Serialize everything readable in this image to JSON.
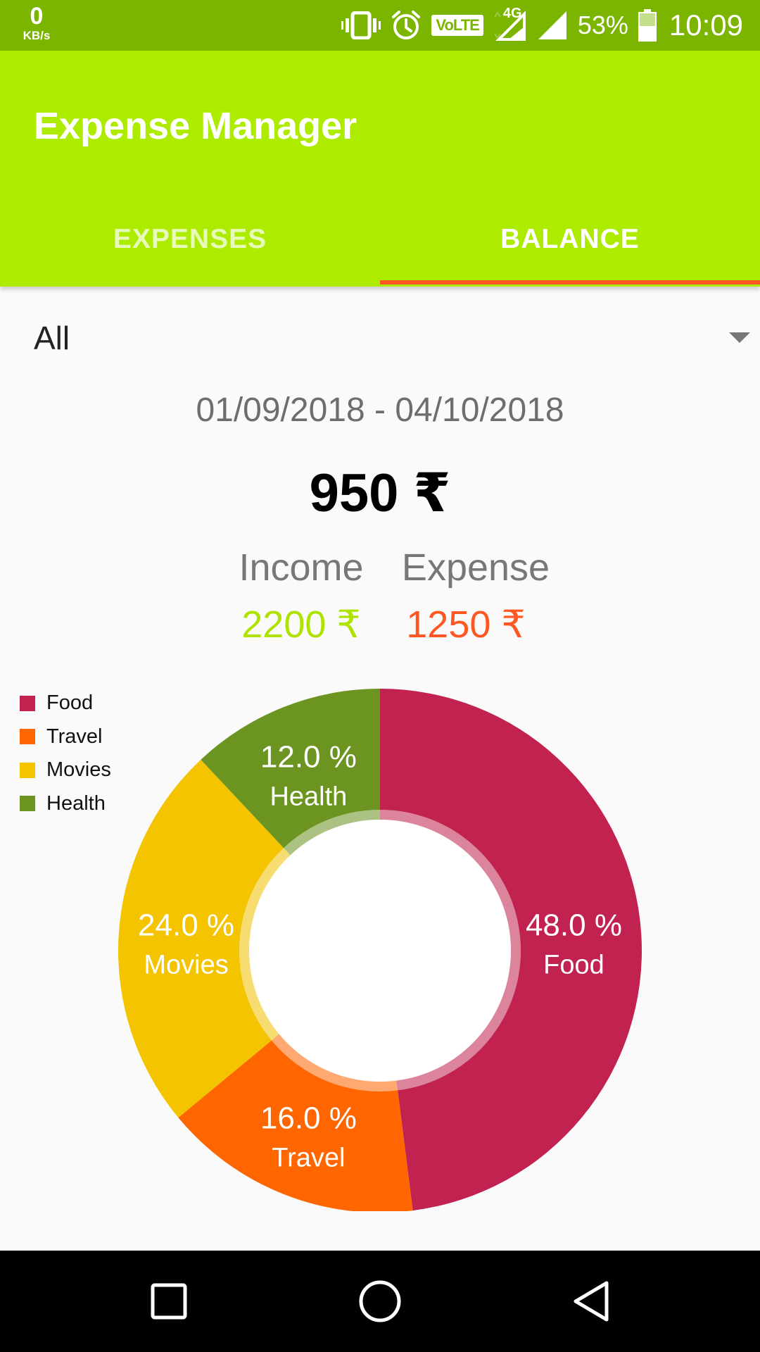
{
  "status_bar": {
    "net_speed_value": "0",
    "net_speed_unit": "KB/s",
    "volte": "VoLTE",
    "network": "4G",
    "battery": "53%",
    "time": "10:09",
    "icons": [
      "vibrate-icon",
      "alarm-icon",
      "volte-icon",
      "signal-4g-icon",
      "signal-icon",
      "battery-icon"
    ]
  },
  "app_bar": {
    "title": "Expense Manager",
    "tabs": [
      {
        "label": "EXPENSES",
        "selected": false
      },
      {
        "label": "BALANCE",
        "selected": true
      }
    ]
  },
  "filter": {
    "value": "All"
  },
  "summary": {
    "date_range": "01/09/2018 - 04/10/2018",
    "balance": "950 ₹",
    "income_label": "Income",
    "income_value": "2200 ₹",
    "expense_label": "Expense",
    "expense_value": "1250 ₹"
  },
  "colors": {
    "status_bar": "#7cb500",
    "app_bar": "#adeb00",
    "tab_indicator": "#ff5722",
    "income": "#aee300",
    "expense": "#ff5722"
  },
  "chart_data": {
    "type": "pie",
    "style": "donut",
    "legend_position": "top-left",
    "slices": [
      {
        "name": "Food",
        "value": 48.0,
        "label": "48.0 %",
        "color": "#c2224f"
      },
      {
        "name": "Travel",
        "value": 16.0,
        "label": "16.0 %",
        "color": "#ff6600"
      },
      {
        "name": "Movies",
        "value": 24.0,
        "label": "24.0 %",
        "color": "#f4c400"
      },
      {
        "name": "Health",
        "value": 12.0,
        "label": "12.0 %",
        "color": "#6b9421"
      }
    ]
  },
  "nav_bar": {
    "buttons": [
      "recent-apps-icon",
      "home-icon",
      "back-icon"
    ]
  }
}
